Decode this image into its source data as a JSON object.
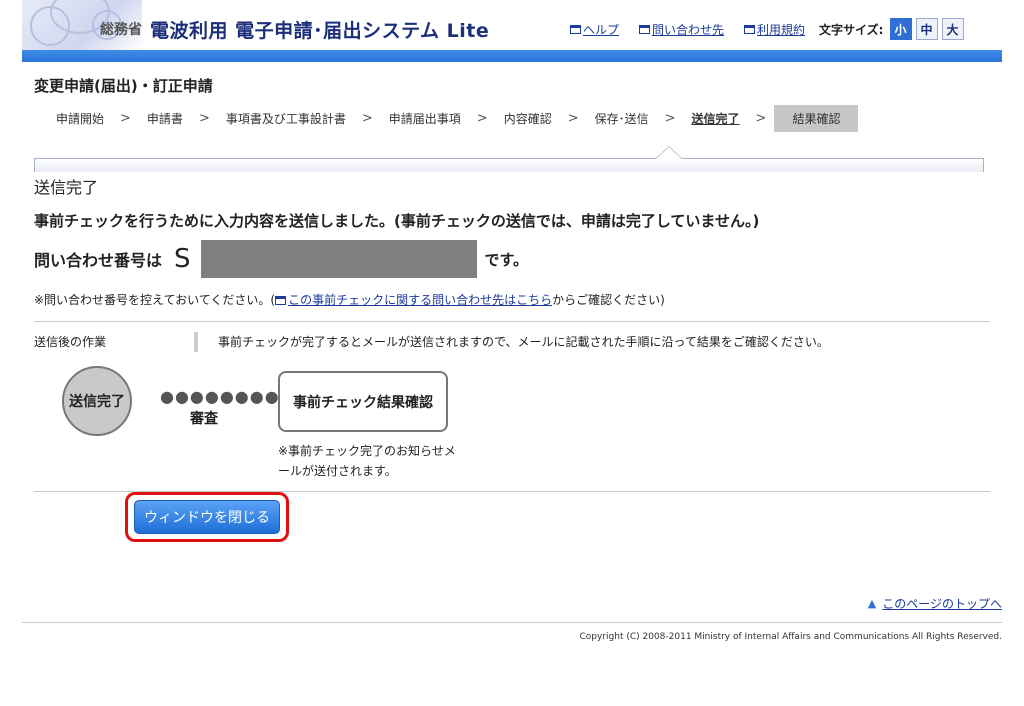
{
  "header": {
    "ministry": "総務省",
    "title": "電波利用 電子申請･届出システム Lite",
    "links": [
      {
        "label": "ヘルプ"
      },
      {
        "label": "問い合わせ先"
      },
      {
        "label": "利用規約"
      }
    ],
    "font_size_label": "文字サイズ:",
    "font_sizes": [
      "小",
      "中",
      "大"
    ],
    "font_size_selected": "小"
  },
  "page_title": "変更申請(届出)・訂正申請",
  "steps": [
    "申請開始",
    "申請書",
    "事項書及び工事設計書",
    "申請届出事項",
    "内容確認",
    "保存･送信",
    "送信完了",
    "結果確認"
  ],
  "steps_current": "送信完了",
  "steps_next": "結果確認",
  "section_title": "送信完了",
  "message": "事前チェックを行うために入力内容を送信しました。(事前チェックの送信では、申請は完了していません。)",
  "inquiry": {
    "prefix": "問い合わせ番号は",
    "number_start": "S",
    "suffix": "です。"
  },
  "note": {
    "before": "※問い合わせ番号を控えておいてください。(",
    "link": "この事前チェックに関する問い合わせ先はこちら",
    "after": "からご確認ください)"
  },
  "after_work": {
    "label": "送信後の作業",
    "text": "事前チェックが完了するとメールが送信されますので、メールに記載された手順に沿って結果をご確認ください。"
  },
  "flow": {
    "done": "送信完了",
    "dots": "●●●●●●●●",
    "review": "審査",
    "result_box": "事前チェック結果確認",
    "note": "※事前チェック完了のお知らせメールが送付されます。"
  },
  "close_button": "ウィンドウを閉じる",
  "to_top": "このページのトップへ",
  "copyright": "Copyright (C) 2008-2011 Ministry of Internal Affairs and Communications All Rights Reserved.",
  "colors": {
    "accent": "#2a74d8",
    "highlight": "#e01010"
  }
}
